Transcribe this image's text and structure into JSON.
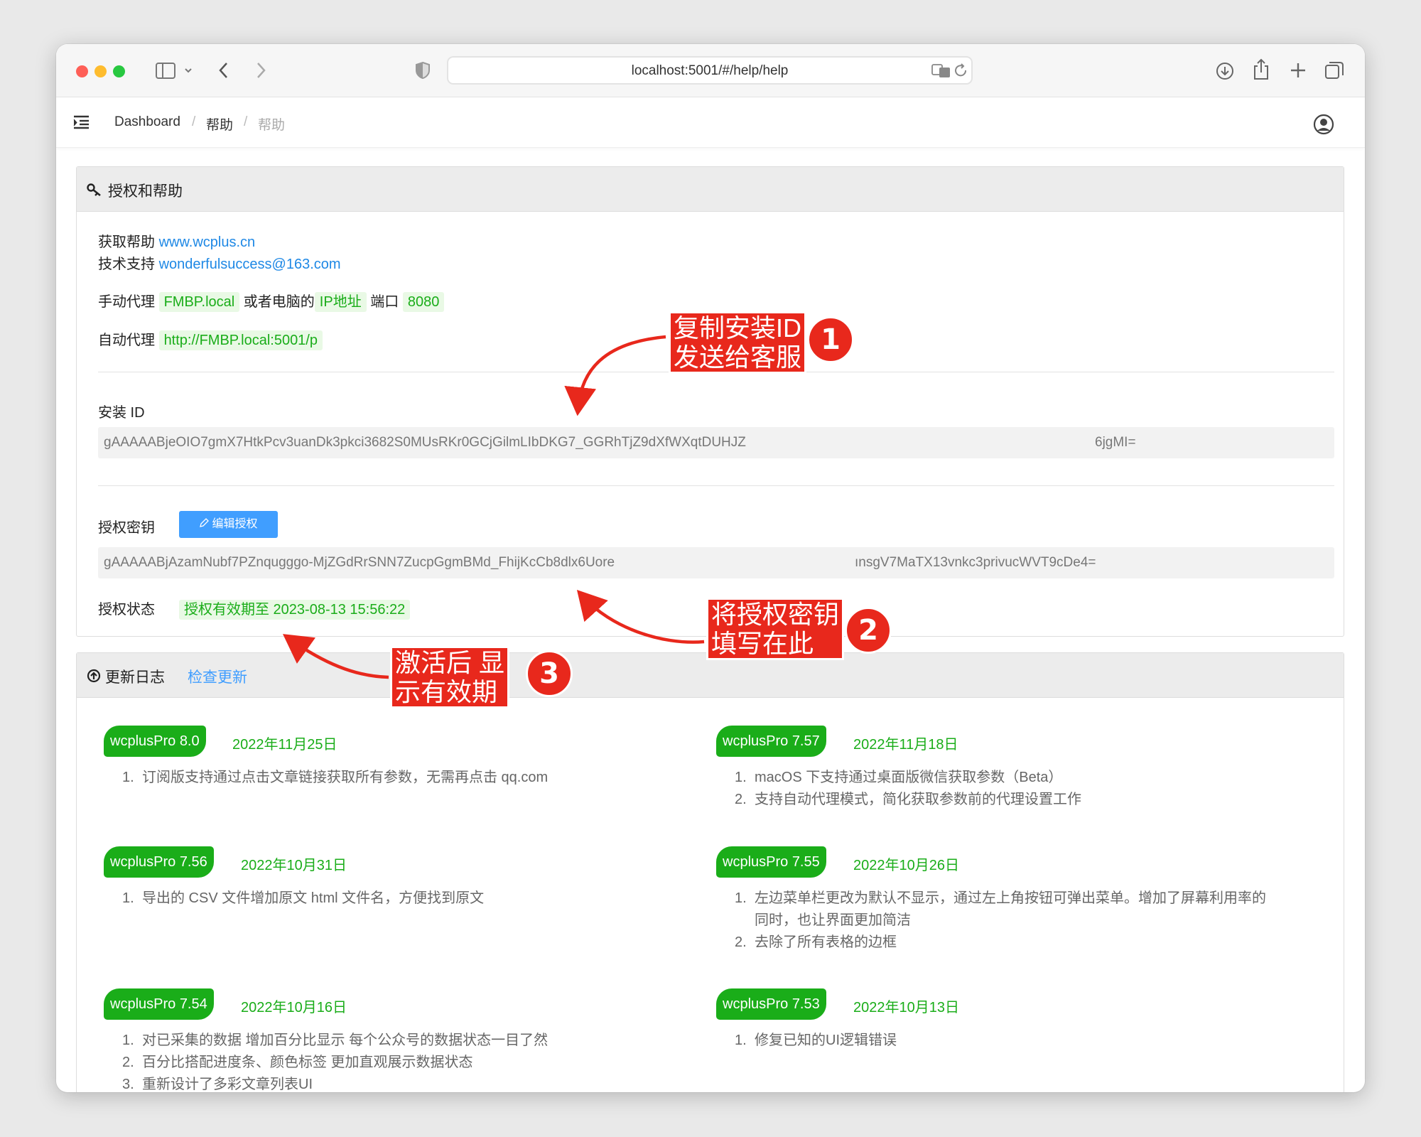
{
  "browser": {
    "url": "localhost:5001/#/help/help"
  },
  "breadcrumb": {
    "items": [
      "Dashboard",
      "帮助",
      "帮助"
    ],
    "separator": "/"
  },
  "help_card": {
    "title": "授权和帮助",
    "get_help_label": "获取帮助",
    "get_help_link": "www.wcplus.cn",
    "support_label": "技术支持",
    "support_email": "wonderfulsuccess@163.com",
    "manual_proxy_label": "手动代理",
    "manual_proxy_host": "FMBP.local",
    "or_text": "或者电脑的",
    "ip_label": "IP地址",
    "port_label": "端口",
    "port_value": "8080",
    "auto_proxy_label": "自动代理",
    "auto_proxy_url": "http://FMBP.local:5001/p",
    "install_id_label": "安装 ID",
    "install_id_part1": "gAAAAABjeOIO7gmX7HtkPcv3uanDk3pkci3682S0MUsRKr0GCjGilmLIbDKG7_GGRhTjZ9dXfWXqtDUHJZ",
    "install_id_part2": "6jgMI=",
    "license_key_label": "授权密钥",
    "edit_license_button": "编辑授权",
    "license_key_part1": "gAAAAABjAzamNubf7PZnqugggo-MjZGdRrSNN7ZucpGgmBMd_FhijKcCb8dlx6Uore",
    "license_key_part2": "ınsgV7MaTX13vnkc3privucWVT9cDe4=",
    "license_status_label": "授权状态",
    "license_status_value": "授权有效期至 2023-08-13 15:56:22"
  },
  "changelog": {
    "title": "更新日志",
    "check_update_link": "检查更新",
    "versions": [
      {
        "name": "wcplusPro 8.0",
        "date": "2022年11月25日",
        "items": [
          "订阅版支持通过点击文章链接获取所有参数，无需再点击 qq.com"
        ]
      },
      {
        "name": "wcplusPro 7.57",
        "date": "2022年11月18日",
        "items": [
          "macOS 下支持通过桌面版微信获取参数（Beta）",
          "支持自动代理模式，简化获取参数前的代理设置工作"
        ]
      },
      {
        "name": "wcplusPro 7.56",
        "date": "2022年10月31日",
        "items": [
          "导出的 CSV 文件增加原文 html 文件名，方便找到原文"
        ]
      },
      {
        "name": "wcplusPro 7.55",
        "date": "2022年10月26日",
        "items": [
          "左边菜单栏更改为默认不显示，通过左上角按钮可弹出菜单。增加了屏幕利用率的",
          "同时，也让界面更加简洁",
          "去除了所有表格的边框"
        ]
      },
      {
        "name": "wcplusPro 7.54",
        "date": "2022年10月16日",
        "items": [
          "对已采集的数据 增加百分比显示 每个公众号的数据状态一目了然",
          "百分比搭配进度条、颜色标签 更加直观展示数据状态",
          "重新设计了多彩文章列表UI"
        ]
      },
      {
        "name": "wcplusPro 7.53",
        "date": "2022年10月13日",
        "items": [
          "修复已知的UI逻辑错误"
        ]
      }
    ]
  },
  "annotations": [
    {
      "line1": "复制安装ID",
      "line2": "发送给客服",
      "number": "1"
    },
    {
      "line1": "将授权密钥",
      "line2": "填写在此",
      "number": "2"
    },
    {
      "line1": "激活后 显",
      "line2": "示有效期",
      "number": "3"
    }
  ],
  "colors": {
    "accent_green": "#1aad19",
    "link_blue": "#1e88e5",
    "annotation_red": "#e8281c",
    "button_blue": "#409eff"
  },
  "icons": [
    "sidebar-icon",
    "chevron-left-icon",
    "chevron-right-icon",
    "shield-icon",
    "translate-icon",
    "reload-icon",
    "download-icon",
    "share-icon",
    "plus-icon",
    "tabs-icon",
    "menu-icon",
    "user-icon",
    "key-icon",
    "upload-circle-icon",
    "pencil-icon"
  ]
}
